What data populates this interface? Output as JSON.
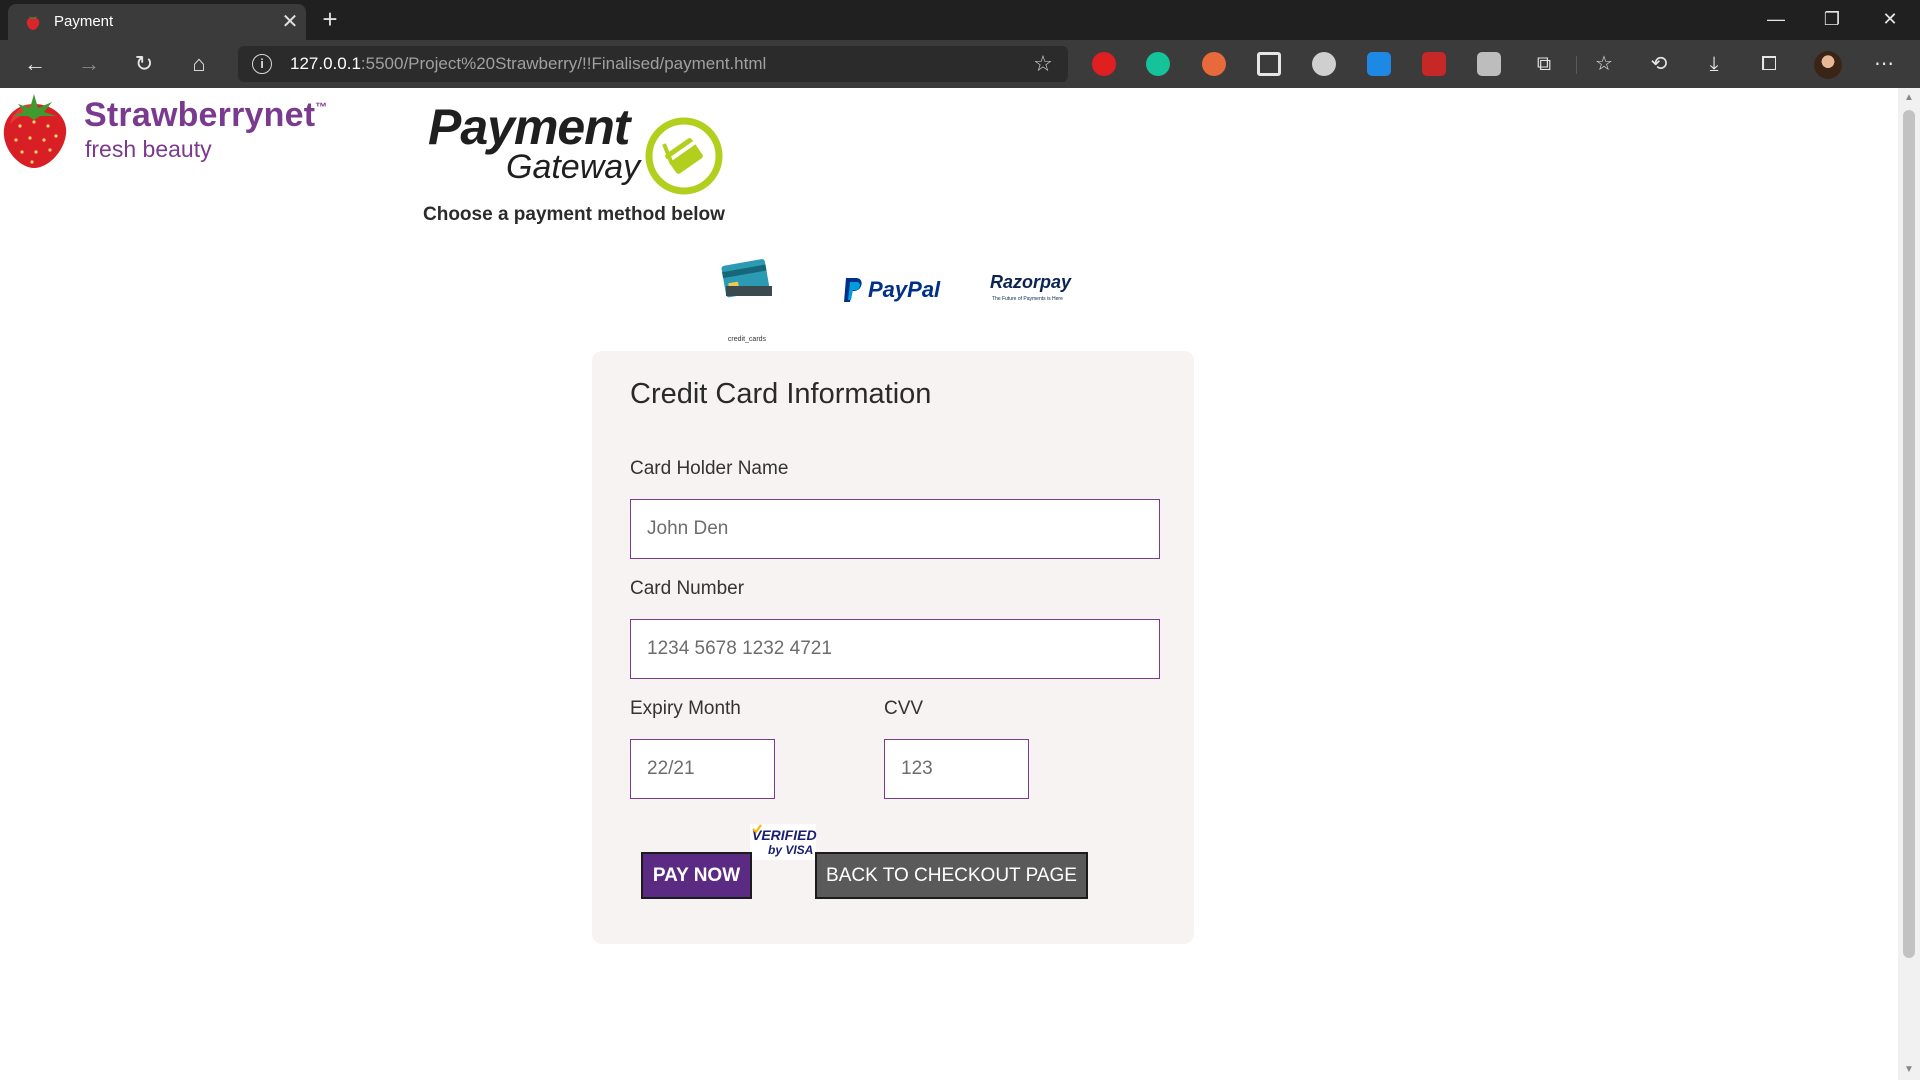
{
  "browser": {
    "tab_title": "Payment",
    "tab_close": "✕",
    "new_tab": "+",
    "url_host": "127.0.0.1",
    "url_rest": ":5500/Project%20Strawberry/!!Finalised/payment.html",
    "window_controls": {
      "minimize": "—",
      "restore": "❐",
      "close": "✕"
    },
    "nav": {
      "back": "←",
      "forward": "→",
      "reload": "↻",
      "home": "⌂"
    },
    "toolbar_icons": [
      "puzzle-icon",
      "favorites-icon",
      "history-icon",
      "downloads-icon",
      "collections-icon",
      "more-icon"
    ],
    "extensions": [
      "ublock",
      "grammarly",
      "eyedropper",
      "window-resizer",
      "tampermonkey",
      "translator",
      "reader",
      "privacy"
    ],
    "colors": {
      "frame": "#202020",
      "toolbar": "#3b3b3b",
      "omnibox": "#2b2b2b"
    }
  },
  "header": {
    "brand_name": "Strawberrynet",
    "brand_tm": "™",
    "brand_tagline": "fresh beauty",
    "gateway_word1": "Payment",
    "gateway_word2": "Gateway",
    "instruction": "Choose a payment method below"
  },
  "payment_methods": {
    "card_caption": "credit_cards",
    "paypal": "PayPal",
    "razorpay": "Razorpay",
    "razorpay_tagline": "The Future of Payments is Here"
  },
  "form": {
    "title": "Credit Card Information",
    "holder_label": "Card Holder Name",
    "holder_placeholder": "John Den",
    "number_label": "Card Number",
    "number_placeholder": "1234 5678 1232 4721",
    "expiry_label": "Expiry Month",
    "expiry_placeholder": "22/21",
    "cvv_label": "CVV",
    "cvv_placeholder": "123",
    "verified_line1": "VERIFIED",
    "verified_line2": "by VISA",
    "pay_button": "PAY NOW",
    "back_button": "BACK TO CHECKOUT PAGE"
  },
  "colors": {
    "brand_purple": "#7a3b8e",
    "pay_button": "#5b2b84",
    "back_button": "#5a5a5a",
    "panel_bg": "#f7f3f2",
    "gateway_green": "#b3cf1d"
  }
}
